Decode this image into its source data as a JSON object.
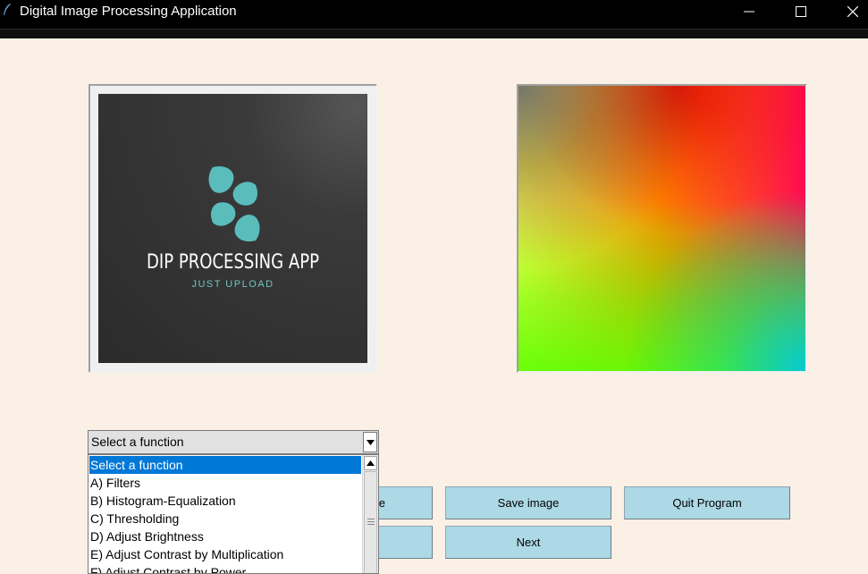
{
  "window": {
    "title": "Digital Image Processing Application",
    "app_icon": "feather-icon",
    "controls": [
      "minimize-icon",
      "maximize-icon",
      "close-icon"
    ]
  },
  "left_image": {
    "logo_title": "DIP PROCESSING APP",
    "logo_subtitle": "JUST UPLOAD",
    "logo_color": "#5bbcbc",
    "background": "#2e2e2e"
  },
  "right_image": {
    "description_colors": [
      "#ffff50",
      "#ff8c00",
      "#ff0a50",
      "#50ff00",
      "#00d0c0",
      "#dd0000"
    ]
  },
  "function_select": {
    "value": "Select a function",
    "options": [
      "Select a function",
      "A) Filters",
      "B) Histogram-Equalization",
      "C) Thresholding",
      "D) Adjust Brightness",
      "E) Adjust Contrast by Multiplication",
      "F) Adjust Contrast by Power"
    ],
    "selected_index": 0
  },
  "buttons": {
    "partial_top": "e",
    "partial_bottom": "",
    "save": "Save image",
    "quit": "Quit Program",
    "next": "Next"
  },
  "colors": {
    "background": "#faf0e6",
    "button": "#add8e6",
    "selection": "#0078d7",
    "titlebar": "#000000"
  }
}
